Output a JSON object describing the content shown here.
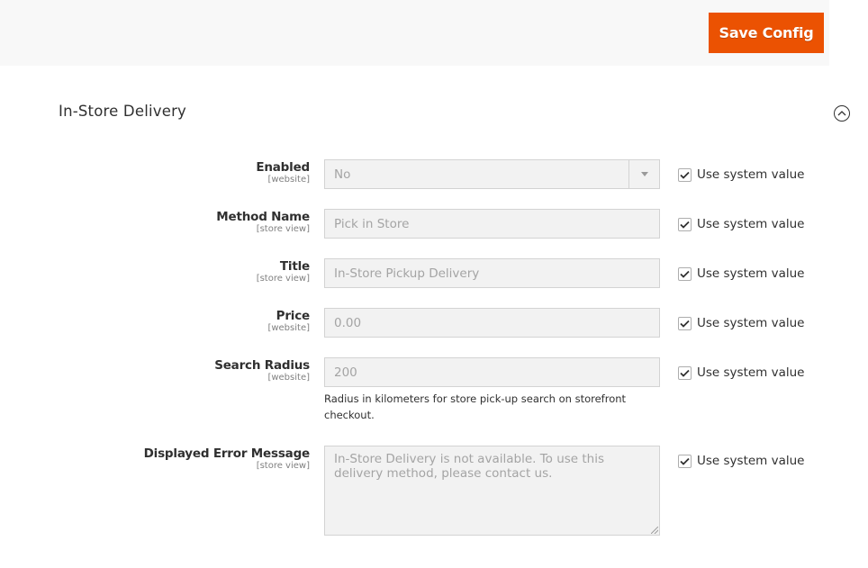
{
  "header": {
    "save_label": "Save Config",
    "save_color": "#eb5202"
  },
  "section": {
    "title": "In-Store Delivery",
    "collapse_icon": "chevron-up-circle-icon"
  },
  "system_value_label": "Use system value",
  "fields": [
    {
      "label": "Enabled",
      "scope": "[website]",
      "type": "select",
      "value": "No",
      "use_system_value": true
    },
    {
      "label": "Method Name",
      "scope": "[store view]",
      "type": "text",
      "value": "Pick in Store",
      "use_system_value": true
    },
    {
      "label": "Title",
      "scope": "[store view]",
      "type": "text",
      "value": "In-Store Pickup Delivery",
      "use_system_value": true
    },
    {
      "label": "Price",
      "scope": "[website]",
      "type": "text",
      "value": "0.00",
      "use_system_value": true
    },
    {
      "label": "Search Radius",
      "scope": "[website]",
      "type": "text",
      "value": "200",
      "use_system_value": true,
      "note": "Radius in kilometers for store pick-up search on storefront checkout."
    },
    {
      "label": "Displayed Error Message",
      "scope": "[store view]",
      "type": "textarea",
      "value": "In-Store Delivery is not available. To use this delivery method, please contact us.",
      "use_system_value": true
    }
  ]
}
